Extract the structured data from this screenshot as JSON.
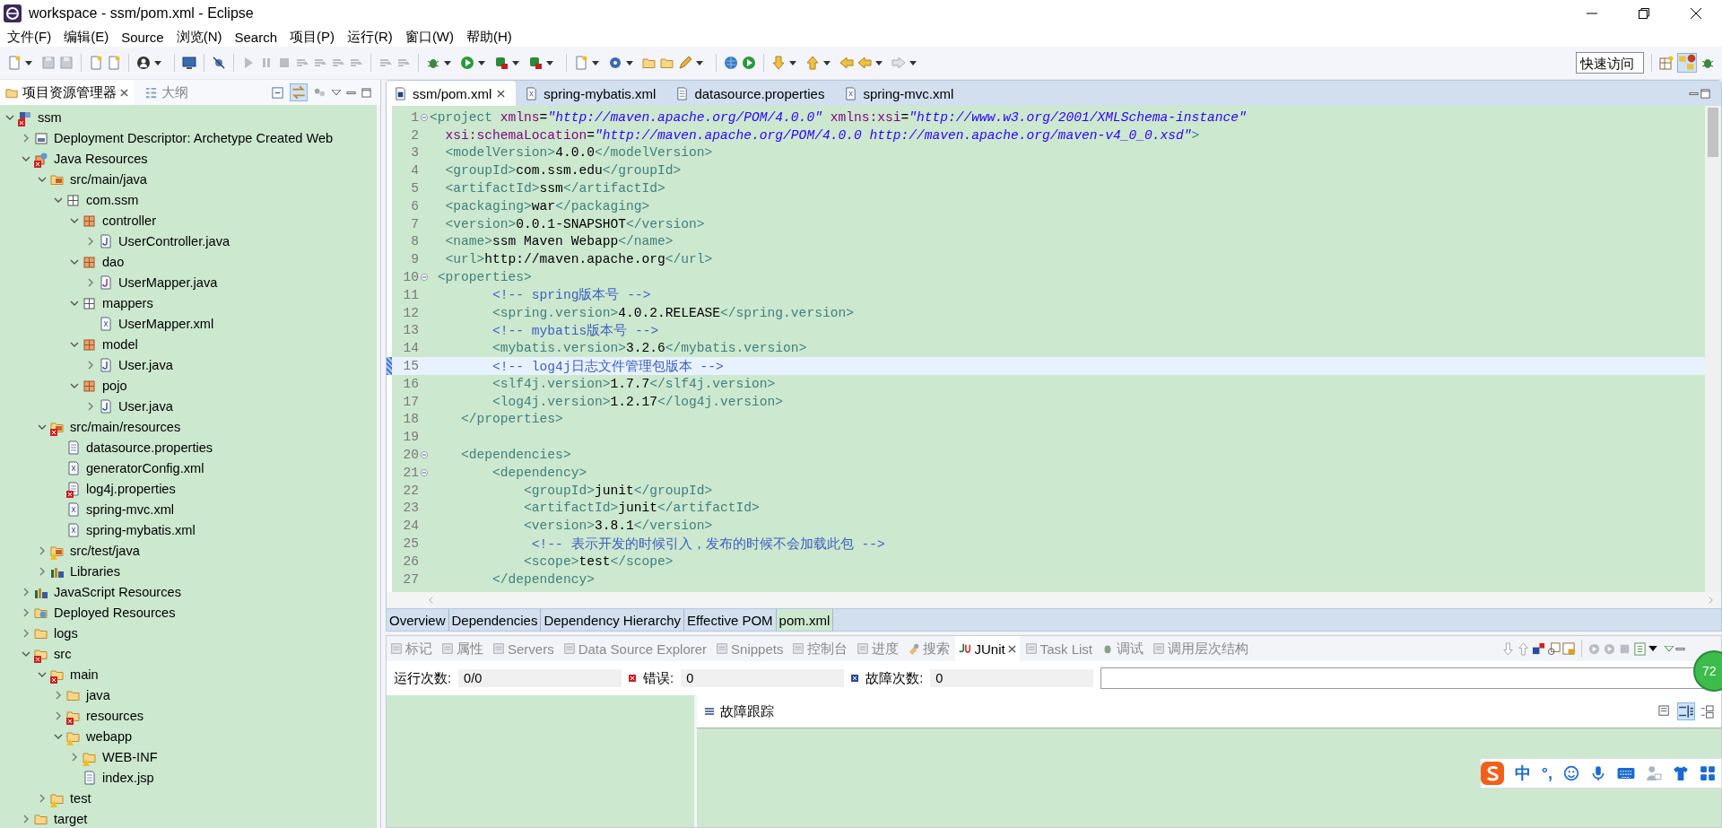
{
  "window": {
    "title": "workspace - ssm/pom.xml - Eclipse"
  },
  "menu": [
    "文件(F)",
    "编辑(E)",
    "Source",
    "浏览(N)",
    "Search",
    "项目(P)",
    "运行(R)",
    "窗口(W)",
    "帮助(H)"
  ],
  "quick_access": {
    "placeholder": "快速访问"
  },
  "left_panel": {
    "tabs": [
      {
        "label": "项目资源管理器",
        "selected": true
      },
      {
        "label": "大纲",
        "selected": false
      }
    ],
    "tree": [
      {
        "label": "ssm",
        "kind": "project",
        "error": true,
        "warning": false,
        "expanded": true,
        "children": [
          {
            "label": "Deployment Descriptor: Archetype Created Web",
            "kind": "descriptor",
            "error": false,
            "warning": false,
            "expanded": false
          },
          {
            "label": "Java Resources",
            "kind": "java-resources",
            "error": true,
            "warning": false,
            "expanded": true,
            "children": [
              {
                "label": "src/main/java",
                "kind": "source-folder",
                "error": false,
                "warning": false,
                "expanded": true,
                "children": [
                  {
                    "label": "com.ssm",
                    "kind": "package-hollow",
                    "error": false,
                    "warning": false,
                    "expanded": true,
                    "children": [
                      {
                        "label": "controller",
                        "kind": "package",
                        "error": false,
                        "warning": false,
                        "expanded": true,
                        "children": [
                          {
                            "label": "UserController.java",
                            "kind": "java",
                            "error": false,
                            "warning": false,
                            "expanded": false
                          }
                        ]
                      },
                      {
                        "label": "dao",
                        "kind": "package",
                        "error": false,
                        "warning": false,
                        "expanded": true,
                        "children": [
                          {
                            "label": "UserMapper.java",
                            "kind": "interface",
                            "error": false,
                            "warning": false,
                            "expanded": false
                          }
                        ]
                      },
                      {
                        "label": "mappers",
                        "kind": "package-hollow",
                        "error": false,
                        "warning": false,
                        "expanded": true,
                        "children": [
                          {
                            "label": "UserMapper.xml",
                            "kind": "xml",
                            "error": false,
                            "warning": false
                          }
                        ]
                      },
                      {
                        "label": "model",
                        "kind": "package",
                        "error": false,
                        "warning": false,
                        "expanded": true,
                        "children": [
                          {
                            "label": "User.java",
                            "kind": "java",
                            "error": false,
                            "warning": false,
                            "expanded": false
                          }
                        ]
                      },
                      {
                        "label": "pojo",
                        "kind": "package",
                        "error": false,
                        "warning": false,
                        "expanded": true,
                        "children": [
                          {
                            "label": "User.java",
                            "kind": "java",
                            "error": false,
                            "warning": false,
                            "expanded": false
                          }
                        ]
                      }
                    ]
                  }
                ]
              },
              {
                "label": "src/main/resources",
                "kind": "source-folder",
                "error": true,
                "warning": false,
                "expanded": true,
                "children": [
                  {
                    "label": "datasource.properties",
                    "kind": "properties",
                    "error": false,
                    "warning": false
                  },
                  {
                    "label": "generatorConfig.xml",
                    "kind": "xml",
                    "error": false,
                    "warning": false
                  },
                  {
                    "label": "log4j.properties",
                    "kind": "properties",
                    "error": true,
                    "warning": false
                  },
                  {
                    "label": "spring-mvc.xml",
                    "kind": "xml",
                    "error": false,
                    "warning": false
                  },
                  {
                    "label": "spring-mybatis.xml",
                    "kind": "xml",
                    "error": false,
                    "warning": false
                  }
                ]
              },
              {
                "label": "src/test/java",
                "kind": "source-folder",
                "error": false,
                "warning": true,
                "expanded": false
              },
              {
                "label": "Libraries",
                "kind": "library",
                "error": false,
                "warning": false,
                "expanded": false
              }
            ]
          },
          {
            "label": "JavaScript Resources",
            "kind": "library",
            "error": false,
            "warning": false,
            "expanded": false
          },
          {
            "label": "Deployed Resources",
            "kind": "deployed",
            "error": false,
            "warning": false,
            "expanded": false
          },
          {
            "label": "logs",
            "kind": "folder",
            "error": false,
            "warning": false,
            "expanded": false
          },
          {
            "label": "src",
            "kind": "folder",
            "error": true,
            "warning": false,
            "expanded": true,
            "children": [
              {
                "label": "main",
                "kind": "folder",
                "error": true,
                "warning": false,
                "expanded": true,
                "children": [
                  {
                    "label": "java",
                    "kind": "folder",
                    "error": false,
                    "warning": false,
                    "expanded": false
                  },
                  {
                    "label": "resources",
                    "kind": "folder",
                    "error": true,
                    "warning": false,
                    "expanded": false
                  },
                  {
                    "label": "webapp",
                    "kind": "folder",
                    "error": false,
                    "warning": true,
                    "expanded": true,
                    "children": [
                      {
                        "label": "WEB-INF",
                        "kind": "folder",
                        "error": false,
                        "warning": true,
                        "expanded": false
                      },
                      {
                        "label": "index.jsp",
                        "kind": "jsp",
                        "error": false,
                        "warning": false
                      }
                    ]
                  }
                ]
              },
              {
                "label": "test",
                "kind": "folder",
                "error": false,
                "warning": true,
                "expanded": false
              }
            ]
          },
          {
            "label": "target",
            "kind": "folder",
            "error": false,
            "warning": false,
            "expanded": false
          }
        ]
      }
    ]
  },
  "editor": {
    "tabs": [
      {
        "label": "ssm/pom.xml",
        "kind": "pom",
        "selected": true
      },
      {
        "label": "spring-mybatis.xml",
        "kind": "xml",
        "selected": false
      },
      {
        "label": "datasource.properties",
        "kind": "properties",
        "selected": false
      },
      {
        "label": "spring-mvc.xml",
        "kind": "xml",
        "selected": false
      }
    ],
    "lines": [
      {
        "number": "1",
        "foldable": true,
        "current": false,
        "segments": [
          {
            "kind": "tag",
            "text": "<project"
          },
          {
            "kind": "attr",
            "text": " xmlns"
          },
          {
            "kind": "text",
            "text": "="
          },
          {
            "kind": "string",
            "text": "\"http://maven.apache.org/POM/4.0.0\""
          },
          {
            "kind": "attr",
            "text": " xmlns:xsi"
          },
          {
            "kind": "text",
            "text": "="
          },
          {
            "kind": "string",
            "text": "\"http://www.w3.org/2001/XMLSchema-instance\""
          }
        ]
      },
      {
        "number": "2",
        "foldable": false,
        "current": false,
        "segments": [
          {
            "kind": "attr",
            "text": "  xsi:schemaLocation"
          },
          {
            "kind": "text",
            "text": "="
          },
          {
            "kind": "string",
            "text": "\"http://maven.apache.org/POM/4.0.0 http://maven.apache.org/maven-v4_0_0.xsd\""
          },
          {
            "kind": "tag",
            "text": ">"
          }
        ]
      },
      {
        "number": "3",
        "foldable": false,
        "current": false,
        "segments": [
          {
            "kind": "tag",
            "text": "  <modelVersion>"
          },
          {
            "kind": "text",
            "text": "4.0.0"
          },
          {
            "kind": "tag",
            "text": "</modelVersion>"
          }
        ]
      },
      {
        "number": "4",
        "foldable": false,
        "current": false,
        "segments": [
          {
            "kind": "tag",
            "text": "  <groupId>"
          },
          {
            "kind": "text",
            "text": "com.ssm.edu"
          },
          {
            "kind": "tag",
            "text": "</groupId>"
          }
        ]
      },
      {
        "number": "5",
        "foldable": false,
        "current": false,
        "segments": [
          {
            "kind": "tag",
            "text": "  <artifactId>"
          },
          {
            "kind": "text",
            "text": "ssm"
          },
          {
            "kind": "tag",
            "text": "</artifactId>"
          }
        ]
      },
      {
        "number": "6",
        "foldable": false,
        "current": false,
        "segments": [
          {
            "kind": "tag",
            "text": "  <packaging>"
          },
          {
            "kind": "text",
            "text": "war"
          },
          {
            "kind": "tag",
            "text": "</packaging>"
          }
        ]
      },
      {
        "number": "7",
        "foldable": false,
        "current": false,
        "segments": [
          {
            "kind": "tag",
            "text": "  <version>"
          },
          {
            "kind": "text",
            "text": "0.0.1-SNAPSHOT"
          },
          {
            "kind": "tag",
            "text": "</version>"
          }
        ]
      },
      {
        "number": "8",
        "foldable": false,
        "current": false,
        "segments": [
          {
            "kind": "tag",
            "text": "  <name>"
          },
          {
            "kind": "text",
            "text": "ssm Maven Webapp"
          },
          {
            "kind": "tag",
            "text": "</name>"
          }
        ]
      },
      {
        "number": "9",
        "foldable": false,
        "current": false,
        "segments": [
          {
            "kind": "tag",
            "text": "  <url>"
          },
          {
            "kind": "text",
            "text": "http://maven.apache.org"
          },
          {
            "kind": "tag",
            "text": "</url>"
          }
        ]
      },
      {
        "number": "10",
        "foldable": true,
        "current": false,
        "segments": [
          {
            "kind": "tag",
            "text": " <properties>"
          }
        ]
      },
      {
        "number": "11",
        "foldable": false,
        "current": false,
        "segments": [
          {
            "kind": "comment",
            "text": "        <!-- spring版本号 -->"
          }
        ]
      },
      {
        "number": "12",
        "foldable": false,
        "current": false,
        "segments": [
          {
            "kind": "tag",
            "text": "        <spring.version>"
          },
          {
            "kind": "text",
            "text": "4.0.2.RELEASE"
          },
          {
            "kind": "tag",
            "text": "</spring.version>"
          }
        ]
      },
      {
        "number": "13",
        "foldable": false,
        "current": false,
        "segments": [
          {
            "kind": "comment",
            "text": "        <!-- mybatis版本号 -->"
          }
        ]
      },
      {
        "number": "14",
        "foldable": false,
        "current": false,
        "segments": [
          {
            "kind": "tag",
            "text": "        <mybatis.version>"
          },
          {
            "kind": "text",
            "text": "3.2.6"
          },
          {
            "kind": "tag",
            "text": "</mybatis.version>"
          }
        ]
      },
      {
        "number": "15",
        "foldable": false,
        "current": true,
        "segments": [
          {
            "kind": "comment",
            "text": "        <!-- log4j日志文件管理包版本 -->"
          }
        ]
      },
      {
        "number": "16",
        "foldable": false,
        "current": false,
        "segments": [
          {
            "kind": "tag",
            "text": "        <slf4j.version>"
          },
          {
            "kind": "text",
            "text": "1.7.7"
          },
          {
            "kind": "tag",
            "text": "</slf4j.version>"
          }
        ]
      },
      {
        "number": "17",
        "foldable": false,
        "current": false,
        "segments": [
          {
            "kind": "tag",
            "text": "        <log4j.version>"
          },
          {
            "kind": "text",
            "text": "1.2.17"
          },
          {
            "kind": "tag",
            "text": "</log4j.version>"
          }
        ]
      },
      {
        "number": "18",
        "foldable": false,
        "current": false,
        "segments": [
          {
            "kind": "tag",
            "text": "    </properties>"
          }
        ]
      },
      {
        "number": "19",
        "foldable": false,
        "current": false
      },
      {
        "number": "20",
        "foldable": true,
        "current": false,
        "segments": [
          {
            "kind": "tag",
            "text": "    <dependencies>"
          }
        ]
      },
      {
        "number": "21",
        "foldable": true,
        "current": false,
        "segments": [
          {
            "kind": "tag",
            "text": "        <dependency>"
          }
        ]
      },
      {
        "number": "22",
        "foldable": false,
        "current": false,
        "segments": [
          {
            "kind": "tag",
            "text": "            <groupId>"
          },
          {
            "kind": "text",
            "text": "junit"
          },
          {
            "kind": "tag",
            "text": "</groupId>"
          }
        ]
      },
      {
        "number": "23",
        "foldable": false,
        "current": false,
        "segments": [
          {
            "kind": "tag",
            "text": "            <artifactId>"
          },
          {
            "kind": "text",
            "text": "junit"
          },
          {
            "kind": "tag",
            "text": "</artifactId>"
          }
        ]
      },
      {
        "number": "24",
        "foldable": false,
        "current": false,
        "segments": [
          {
            "kind": "tag",
            "text": "            <version>"
          },
          {
            "kind": "text",
            "text": "3.8.1"
          },
          {
            "kind": "tag",
            "text": "</version>"
          }
        ]
      },
      {
        "number": "25",
        "foldable": false,
        "current": false,
        "segments": [
          {
            "kind": "comment",
            "text": "             <!-- 表示开发的时候引入，发布的时候不会加载此包 -->"
          }
        ]
      },
      {
        "number": "26",
        "foldable": false,
        "current": false,
        "segments": [
          {
            "kind": "tag",
            "text": "            <scope>"
          },
          {
            "kind": "text",
            "text": "test"
          },
          {
            "kind": "tag",
            "text": "</scope>"
          }
        ]
      },
      {
        "number": "27",
        "foldable": false,
        "current": false,
        "segments": [
          {
            "kind": "tag",
            "text": "        </dependency>"
          }
        ]
      }
    ],
    "page_tabs": [
      {
        "label": "Overview",
        "selected": false
      },
      {
        "label": "Dependencies",
        "selected": false
      },
      {
        "label": "Dependency Hierarchy",
        "selected": false
      },
      {
        "label": "Effective POM",
        "selected": false
      },
      {
        "label": "pom.xml",
        "selected": true
      }
    ]
  },
  "bottom_panel": {
    "tabs": [
      {
        "label": "标记",
        "kind": "markers",
        "selected": false
      },
      {
        "label": "属性",
        "kind": "properties",
        "selected": false
      },
      {
        "label": "Servers",
        "kind": "servers",
        "selected": false
      },
      {
        "label": "Data Source Explorer",
        "kind": "database",
        "selected": false
      },
      {
        "label": "Snippets",
        "kind": "snippets",
        "selected": false
      },
      {
        "label": "控制台",
        "kind": "console",
        "selected": false
      },
      {
        "label": "进度",
        "kind": "progress",
        "selected": false
      },
      {
        "label": "搜索",
        "kind": "search",
        "selected": false
      },
      {
        "label": "JUnit",
        "kind": "junit",
        "selected": true
      },
      {
        "label": "Task List",
        "kind": "tasks",
        "selected": false
      },
      {
        "label": "调试",
        "kind": "debug",
        "selected": false
      },
      {
        "label": "调用层次结构",
        "kind": "hierarchy",
        "selected": false
      }
    ],
    "junit": {
      "runs_label": "运行次数:",
      "runs": "0/0",
      "errors_label": "错误:",
      "errors": "0",
      "failures_label": "故障次数:",
      "failures": "0",
      "progress": {
        "level": 0
      },
      "trace_title": "故障跟踪"
    }
  },
  "floating_ball": {
    "text": "72"
  },
  "ime_toolbar": {
    "mode": "中",
    "punctuation": "°,"
  }
}
